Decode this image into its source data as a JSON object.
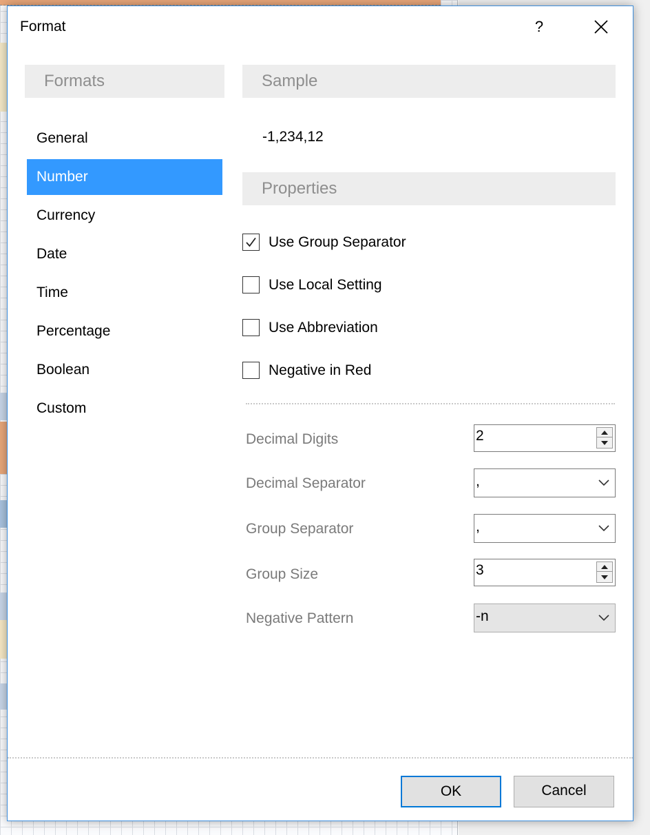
{
  "dialog": {
    "title": "Format",
    "help_label": "?",
    "close_icon": "close-icon"
  },
  "formats": {
    "header": "Formats",
    "items": [
      {
        "label": "General",
        "selected": false
      },
      {
        "label": "Number",
        "selected": true
      },
      {
        "label": "Currency",
        "selected": false
      },
      {
        "label": "Date",
        "selected": false
      },
      {
        "label": "Time",
        "selected": false
      },
      {
        "label": "Percentage",
        "selected": false
      },
      {
        "label": "Boolean",
        "selected": false
      },
      {
        "label": "Custom",
        "selected": false
      }
    ]
  },
  "sample": {
    "header": "Sample",
    "value": "-1,234,12"
  },
  "properties": {
    "header": "Properties",
    "checkboxes": [
      {
        "label": "Use Group Separator",
        "checked": true
      },
      {
        "label": "Use Local Setting",
        "checked": false
      },
      {
        "label": "Use Abbreviation",
        "checked": false
      },
      {
        "label": "Negative in Red",
        "checked": false
      }
    ],
    "decimal_digits": {
      "label": "Decimal Digits",
      "value": "2"
    },
    "decimal_separator": {
      "label": "Decimal Separator",
      "value": ","
    },
    "group_separator": {
      "label": "Group Separator",
      "value": ","
    },
    "group_size": {
      "label": "Group Size",
      "value": "3"
    },
    "negative_pattern": {
      "label": "Negative Pattern",
      "value": "-n"
    }
  },
  "buttons": {
    "ok": "OK",
    "cancel": "Cancel"
  },
  "colors": {
    "selection": "#3399ff",
    "accent_border": "#0078d7",
    "header_bg": "#ededed"
  }
}
